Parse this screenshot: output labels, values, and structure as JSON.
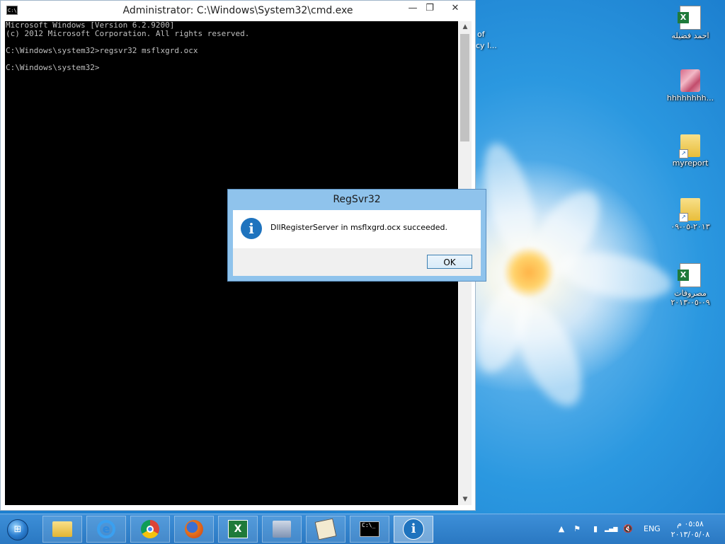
{
  "cmd_window": {
    "title": "Administrator: C:\\Windows\\System32\\cmd.exe",
    "icon_text": "C:\\.",
    "controls": {
      "minimize": "—",
      "maximize": "❐",
      "close": "✕"
    },
    "console_lines": [
      "Microsoft Windows [Version 6.2.9200]",
      "(c) 2012 Microsoft Corporation. All rights reserved.",
      "",
      "C:\\Windows\\system32>regsvr32 msflxgrd.ocx",
      "",
      "C:\\Windows\\system32>"
    ],
    "scroll_up": "▲",
    "scroll_down": "▼"
  },
  "dialog": {
    "title": "RegSvr32",
    "icon": "info-icon",
    "icon_glyph": "i",
    "message": "DllRegisterServer in msflxgrd.ocx succeeded.",
    "ok_label": "OK"
  },
  "desktop": {
    "partial_label_top": "of",
    "partial_label_bottom": "cy I...",
    "icons": [
      {
        "label": "احمد فضيله",
        "icon": "excel-file-icon"
      },
      {
        "label": "hhhhhhhh...",
        "icon": "winrar-archive-icon"
      },
      {
        "label": "myreport",
        "icon": "folder-shortcut-icon"
      },
      {
        "label": "٢٠١٣-٠٥-٠٩",
        "icon": "folder-shortcut-icon"
      },
      {
        "label": "مصروفات ٠٩-٠٥-٢٠١٣",
        "icon": "excel-file-icon"
      }
    ]
  },
  "taskbar": {
    "start_glyph": "⊞",
    "apps": [
      {
        "name": "file-explorer",
        "icon": "folder-icon"
      },
      {
        "name": "internet-explorer",
        "icon": "ie-icon",
        "glyph": "e"
      },
      {
        "name": "google-chrome",
        "icon": "chrome-icon"
      },
      {
        "name": "firefox",
        "icon": "firefox-icon"
      },
      {
        "name": "excel",
        "icon": "excel-icon",
        "glyph": "X"
      },
      {
        "name": "setup",
        "icon": "installer-icon"
      },
      {
        "name": "signature-app",
        "icon": "signature-icon"
      },
      {
        "name": "cmd",
        "icon": "cmd-icon",
        "glyph": "C:\\_"
      },
      {
        "name": "regsvr32",
        "icon": "info-icon",
        "glyph": "i",
        "active": true
      }
    ],
    "tray": {
      "show_hidden_glyph": "▲",
      "flag_glyph": "⚑",
      "battery_glyph": "▮",
      "network_glyph": "▂▄▆",
      "volume_glyph": "🔇",
      "language": "ENG",
      "time": "٠٥:٥٨ م",
      "date": "٢٠١٣/٠٥/٠٨"
    }
  }
}
